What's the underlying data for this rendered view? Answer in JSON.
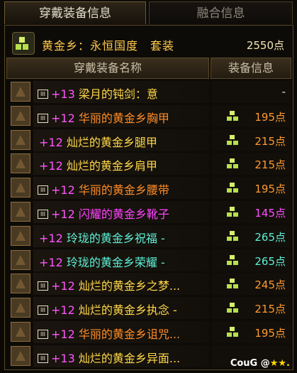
{
  "tabs": [
    "穿戴装备信息",
    "融合信息"
  ],
  "set": {
    "name": "黄金乡：永恒国度　套装",
    "points": "2550点"
  },
  "headers": {
    "name": "穿戴装备名称",
    "info": "装备信息"
  },
  "items": [
    {
      "slot": "weapon-icon",
      "bound": true,
      "enh": "+13",
      "name": "梁月的钝剑：意",
      "color": "c-yellow",
      "set_icon": false,
      "points": "-",
      "pcolor": "p-white"
    },
    {
      "slot": "chest-icon",
      "bound": true,
      "enh": "+12",
      "name": "华丽的黄金乡胸甲",
      "color": "c-orange",
      "set_icon": true,
      "points": "195点",
      "pcolor": "p-orange"
    },
    {
      "slot": "legs-icon",
      "bound": false,
      "enh": "+12",
      "name": "灿烂的黄金乡腿甲",
      "color": "c-yellow",
      "set_icon": true,
      "points": "215点",
      "pcolor": "p-orange"
    },
    {
      "slot": "shoulder-icon",
      "bound": false,
      "enh": "+12",
      "name": "灿烂的黄金乡肩甲",
      "color": "c-yellow",
      "set_icon": true,
      "points": "215点",
      "pcolor": "p-orange"
    },
    {
      "slot": "belt-icon",
      "bound": true,
      "enh": "+12",
      "name": "华丽的黄金乡腰带",
      "color": "c-orange",
      "set_icon": true,
      "points": "195点",
      "pcolor": "p-orange"
    },
    {
      "slot": "boots-icon",
      "bound": true,
      "enh": "+12",
      "name": "闪耀的黄金乡靴子",
      "color": "c-magenta",
      "set_icon": true,
      "points": "145点",
      "pcolor": "p-magenta"
    },
    {
      "slot": "amulet-icon",
      "bound": false,
      "enh": "+12",
      "name": "玲珑的黄金乡祝福 -",
      "color": "c-cyan",
      "set_icon": true,
      "points": "265点",
      "pcolor": "p-cyan"
    },
    {
      "slot": "bracelet-icon",
      "bound": false,
      "enh": "+12",
      "name": "玲珑的黄金乡荣耀 -",
      "color": "c-cyan",
      "set_icon": true,
      "points": "265点",
      "pcolor": "p-cyan"
    },
    {
      "slot": "ring-icon",
      "bound": true,
      "enh": "+12",
      "name": "灿烂的黄金乡之梦...",
      "color": "c-yellow",
      "set_icon": true,
      "points": "245点",
      "pcolor": "p-orange"
    },
    {
      "slot": "support-icon",
      "bound": true,
      "enh": "+12",
      "name": "灿烂的黄金乡执念 -",
      "color": "c-yellow",
      "set_icon": true,
      "points": "215点",
      "pcolor": "p-orange"
    },
    {
      "slot": "gem-icon",
      "bound": true,
      "enh": "+12",
      "name": "华丽的黄金乡诅咒...",
      "color": "c-orange",
      "set_icon": true,
      "points": "195点",
      "pcolor": "p-orange"
    },
    {
      "slot": "earring-icon",
      "bound": true,
      "enh": "+13",
      "name": "灿烂的黄金乡异面...",
      "color": "c-yellow",
      "set_icon": false,
      "points": "",
      "pcolor": "p-orange"
    }
  ],
  "watermark": {
    "text": "CouG @",
    "stars": "★★."
  }
}
